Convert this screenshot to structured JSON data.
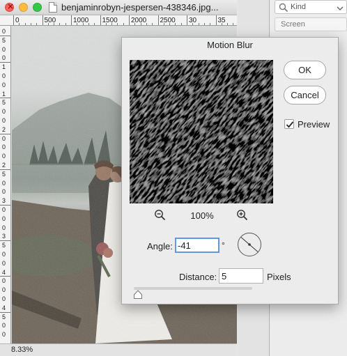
{
  "document": {
    "title": "benjaminrobyn-jespersen-438346.jpg...",
    "ruler_top_labels": [
      "0",
      "500",
      "1000",
      "1500",
      "2000",
      "2500",
      "30",
      "35"
    ],
    "ruler_left_labels": [
      "0",
      "5",
      "0",
      "0",
      "1",
      "0",
      "0",
      "1",
      "5",
      "0",
      "0",
      "2",
      "0",
      "0",
      "0",
      "2",
      "5",
      "0",
      "0",
      "3",
      "0",
      "0",
      "0",
      "3",
      "5",
      "0",
      "0",
      "4",
      "0",
      "0",
      "0",
      "4",
      "5",
      "0",
      "0"
    ],
    "zoom_percent": "8.33%"
  },
  "side_panel": {
    "kind_label": "Kind",
    "screen_label": "Screen"
  },
  "dialog": {
    "title": "Motion Blur",
    "ok_label": "OK",
    "cancel_label": "Cancel",
    "preview_label": "Preview",
    "preview_checked": true,
    "zoom_level": "100%",
    "angle_label": "Angle:",
    "angle_value": "-41",
    "degree_symbol": "°",
    "distance_label": "Distance:",
    "distance_value": "5",
    "distance_unit": "Pixels",
    "distance_slider_fraction": 0.002
  },
  "colors": {
    "focus_ring": "#5d98e6",
    "close": "#fc605b",
    "minimize": "#fdbc40",
    "maximize": "#34c84a"
  }
}
